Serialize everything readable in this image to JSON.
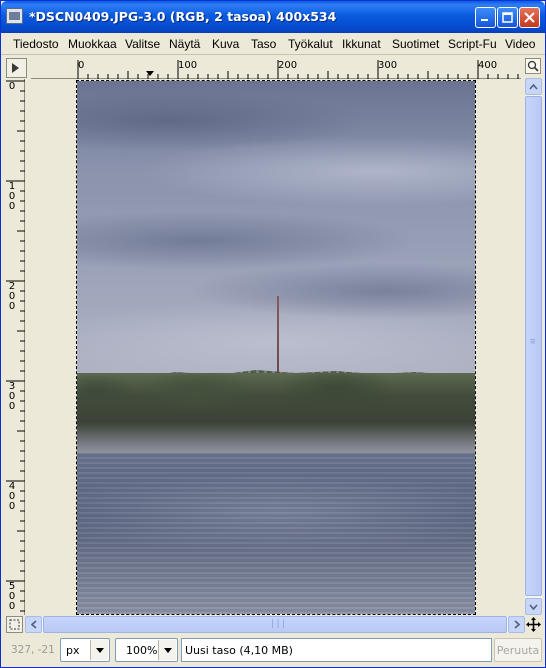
{
  "window": {
    "title": "*DSCN0409.JPG-3.0 (RGB, 2 tasoa) 400x534"
  },
  "menu": {
    "items": [
      {
        "label": "Tiedosto"
      },
      {
        "label": "Muokkaa"
      },
      {
        "label": "Valitse"
      },
      {
        "label": "Näytä"
      },
      {
        "label": "Kuva"
      },
      {
        "label": "Taso"
      },
      {
        "label": "Työkalut"
      },
      {
        "label": "Ikkunat"
      },
      {
        "label": "Suotimet"
      },
      {
        "label": "Script-Fu"
      },
      {
        "label": "Video"
      }
    ]
  },
  "ruler": {
    "horizontal_labels": [
      "0",
      "100",
      "200",
      "300",
      "400"
    ],
    "vertical_labels": [
      "0",
      "100",
      "200",
      "300",
      "400",
      "500"
    ]
  },
  "canvas": {
    "image_description_icon": "landscape-photo"
  },
  "status": {
    "coords": "327, -21",
    "unit": "px",
    "zoom": "100%",
    "message": "Uusi taso (4,10 MB)",
    "cancel_label": "Peruuta"
  },
  "colors": {
    "titlebar": "#0a5be0",
    "window_bg": "#ece9d8",
    "close_button": "#c4381e"
  }
}
